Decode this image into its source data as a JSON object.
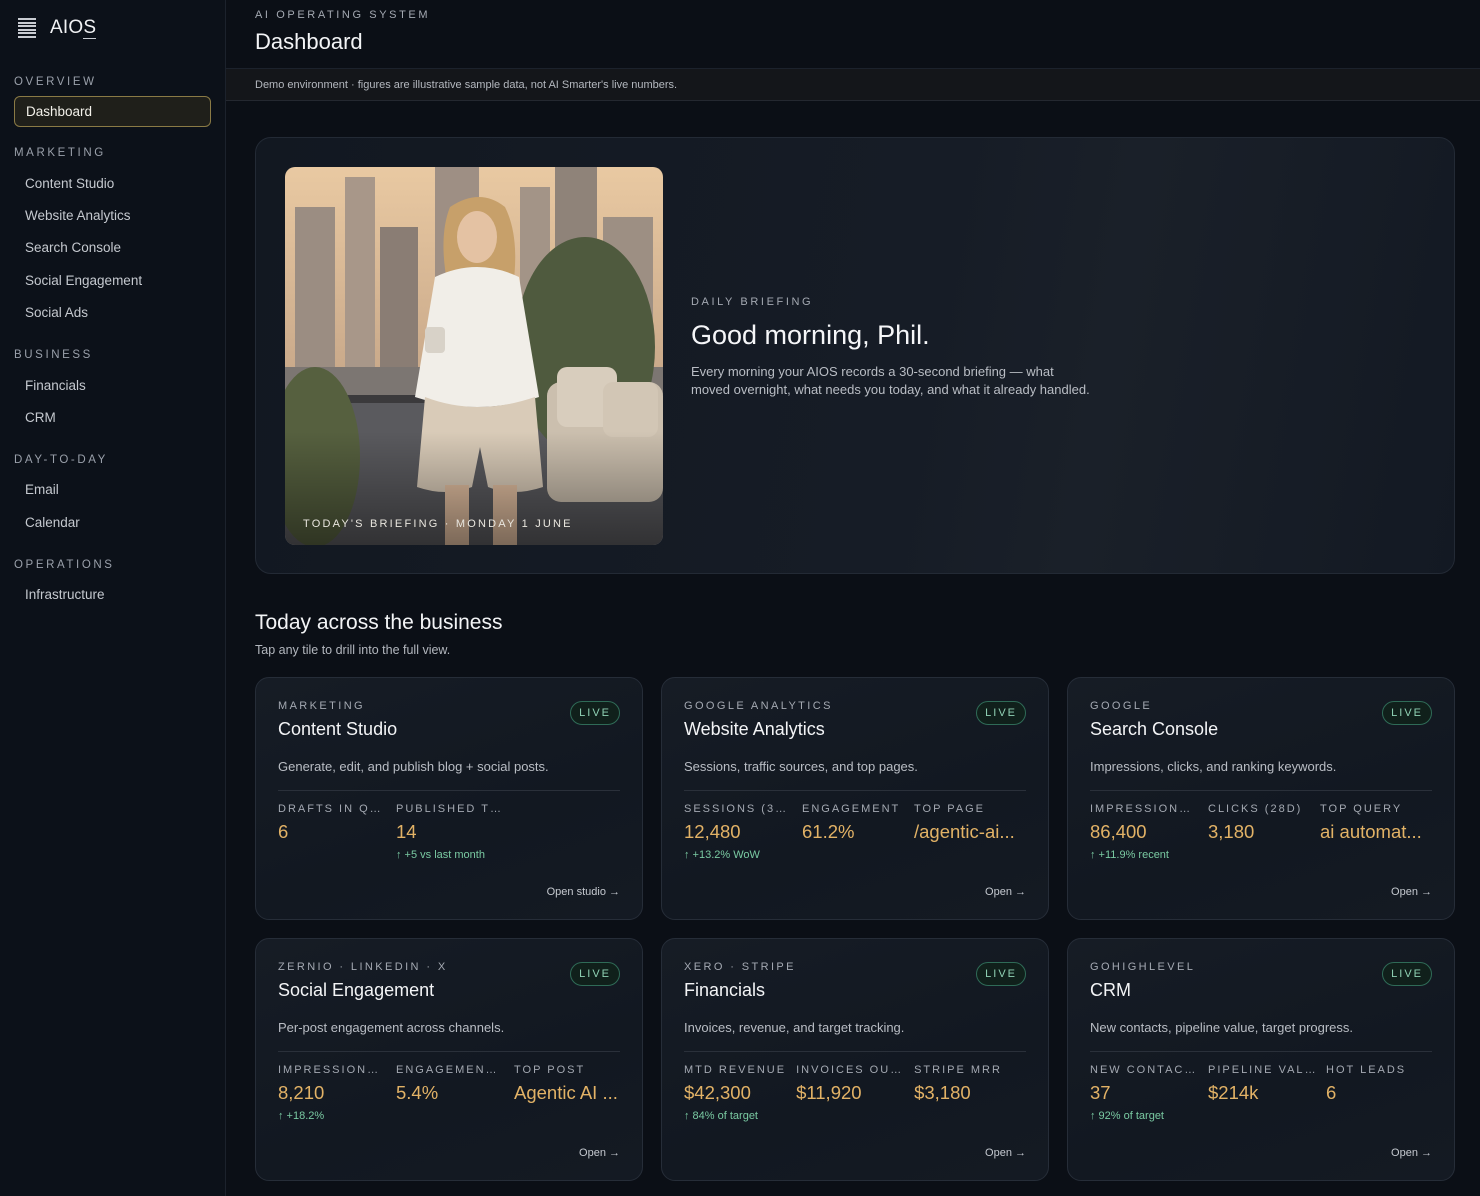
{
  "brand": {
    "name": "AIOS",
    "icon": "menu-icon"
  },
  "sidebar": {
    "sections": [
      {
        "title": "Overview",
        "items": [
          {
            "label": "Dashboard",
            "active": true
          }
        ]
      },
      {
        "title": "Marketing",
        "items": [
          {
            "label": "Content Studio"
          },
          {
            "label": "Website Analytics"
          },
          {
            "label": "Search Console"
          },
          {
            "label": "Social Engagement"
          },
          {
            "label": "Social Ads"
          }
        ]
      },
      {
        "title": "Business",
        "items": [
          {
            "label": "Financials"
          },
          {
            "label": "CRM"
          }
        ]
      },
      {
        "title": "Day-to-day",
        "items": [
          {
            "label": "Email"
          },
          {
            "label": "Calendar"
          }
        ]
      },
      {
        "title": "Operations",
        "items": [
          {
            "label": "Infrastructure"
          }
        ]
      }
    ]
  },
  "header": {
    "eyebrow": "AI OPERATING SYSTEM",
    "title": "Dashboard"
  },
  "notice": "Demo environment · figures are illustrative sample data, not AI Smarter's live numbers.",
  "hero": {
    "photo_caption": "TODAY'S BRIEFING · MONDAY 1 JUNE",
    "eyebrow": "DAILY BRIEFING",
    "title": "Good morning, Phil.",
    "body": "Every morning your AIOS records a 30-second briefing — what moved overnight, what needs you today, and what it already handled."
  },
  "section": {
    "title": "Today across the business",
    "subtitle": "Tap any tile to drill into the full view."
  },
  "cards": [
    {
      "eyebrow": "MARKETING",
      "title": "Content Studio",
      "badge": "LIVE",
      "desc": "Generate, edit, and publish blog + social posts.",
      "metrics": [
        {
          "label": "DRAFTS IN QU...",
          "value": "6",
          "trend": ""
        },
        {
          "label": "PUBLISHED TH...",
          "value": "14",
          "trend": "↑ +5 vs last month"
        }
      ],
      "link": "Open studio →"
    },
    {
      "eyebrow": "GOOGLE ANALYTICS",
      "title": "Website Analytics",
      "badge": "LIVE",
      "desc": "Sessions, traffic sources, and top pages.",
      "metrics": [
        {
          "label": "SESSIONS (30D)",
          "value": "12,480",
          "trend": "↑ +13.2% WoW"
        },
        {
          "label": "ENGAGEMENT",
          "value": "61.2%",
          "trend": ""
        },
        {
          "label": "TOP PAGE",
          "value": "/agentic-ai...",
          "trend": ""
        }
      ],
      "link": "Open →"
    },
    {
      "eyebrow": "GOOGLE",
      "title": "Search Console",
      "badge": "LIVE",
      "desc": "Impressions, clicks, and ranking keywords.",
      "metrics": [
        {
          "label": "IMPRESSIONS ...",
          "value": "86,400",
          "trend": "↑ +11.9% recent"
        },
        {
          "label": "CLICKS (28D)",
          "value": "3,180",
          "trend": ""
        },
        {
          "label": "TOP QUERY",
          "value": "ai automat...",
          "trend": ""
        }
      ],
      "link": "Open →"
    },
    {
      "eyebrow": "ZERNIO · LINKEDIN · X",
      "title": "Social Engagement",
      "badge": "LIVE",
      "desc": "Per-post engagement across channels.",
      "metrics": [
        {
          "label": "IMPRESSIONS ...",
          "value": "8,210",
          "trend": "↑ +18.2%"
        },
        {
          "label": "ENGAGEMENT ...",
          "value": "5.4%",
          "trend": ""
        },
        {
          "label": "TOP POST",
          "value": "Agentic AI ...",
          "trend": ""
        }
      ],
      "link": "Open →"
    },
    {
      "eyebrow": "XERO · STRIPE",
      "title": "Financials",
      "badge": "LIVE",
      "desc": "Invoices, revenue, and target tracking.",
      "metrics": [
        {
          "label": "MTD REVENUE",
          "value": "$42,300",
          "trend": "↑ 84% of target"
        },
        {
          "label": "INVOICES OUT...",
          "value": "$11,920",
          "trend": ""
        },
        {
          "label": "STRIPE MRR",
          "value": "$3,180",
          "trend": ""
        }
      ],
      "link": "Open →"
    },
    {
      "eyebrow": "GOHIGHLEVEL",
      "title": "CRM",
      "badge": "LIVE",
      "desc": "New contacts, pipeline value, target progress.",
      "metrics": [
        {
          "label": "NEW CONTACT...",
          "value": "37",
          "trend": "↑ 92% of target"
        },
        {
          "label": "PIPELINE VALUE",
          "value": "$214k",
          "trend": ""
        },
        {
          "label": "HOT LEADS",
          "value": "6",
          "trend": ""
        }
      ],
      "link": "Open →"
    }
  ],
  "colors": {
    "accent": "#e2b266",
    "live": "#8fd1b4",
    "trend": "#79c9a2",
    "active_border": "#8a7a45"
  }
}
